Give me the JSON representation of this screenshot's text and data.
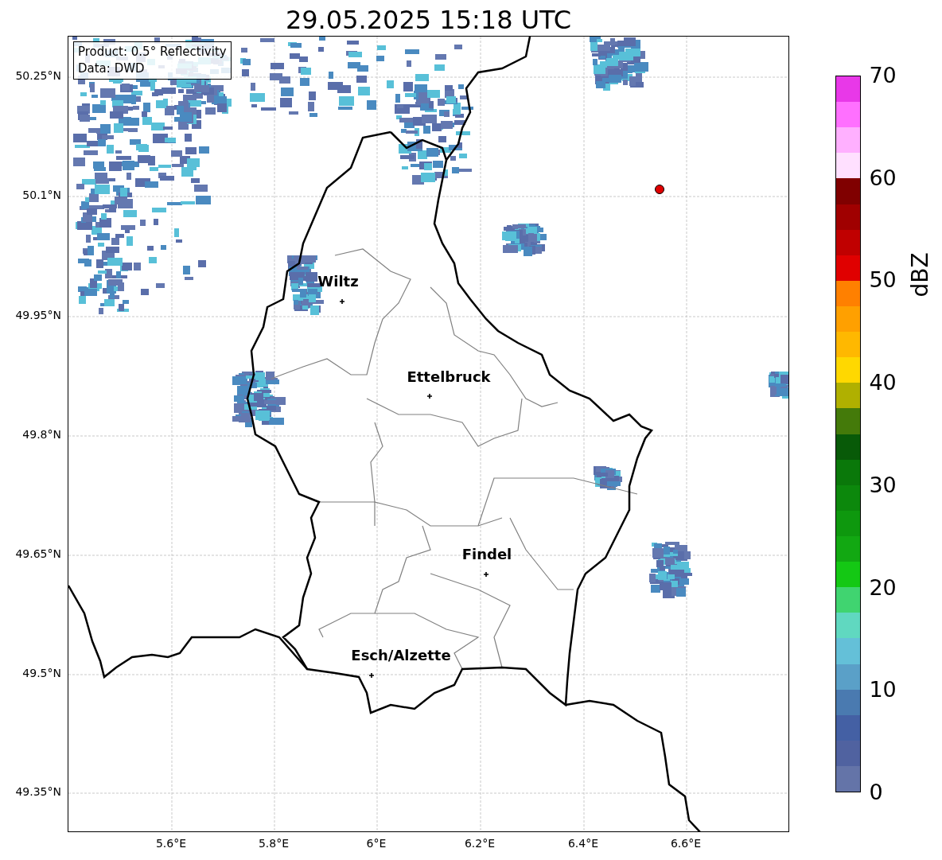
{
  "title": "29.05.2025 15:18 UTC",
  "info_box": {
    "lines": [
      "Product: 0.5° Reflectivity",
      "Data: DWD"
    ]
  },
  "map": {
    "xticks": [
      "5.6°E",
      "5.8°E",
      "6°E",
      "6.2°E",
      "6.4°E",
      "6.6°E"
    ],
    "yticks": [
      "50.25°N",
      "50.1°N",
      "49.95°N",
      "49.8°N",
      "49.65°N",
      "49.5°N",
      "49.35°N"
    ],
    "cities": [
      {
        "name": "Wiltz"
      },
      {
        "name": "Ettelbruck"
      },
      {
        "name": "Findel"
      },
      {
        "name": "Esch/Alzette"
      }
    ]
  },
  "colorbar": {
    "label": "dBZ",
    "ticks": [
      "70",
      "60",
      "50",
      "40",
      "30",
      "20",
      "10",
      "0"
    ],
    "segments": [
      {
        "color": "#e838e8"
      },
      {
        "color": "#ff70ff"
      },
      {
        "color": "#ffb0ff"
      },
      {
        "color": "#ffe0ff"
      },
      {
        "color": "#800000"
      },
      {
        "color": "#a00000"
      },
      {
        "color": "#c00000"
      },
      {
        "color": "#e00000"
      },
      {
        "color": "#ff8000"
      },
      {
        "color": "#ffa000"
      },
      {
        "color": "#ffb800"
      },
      {
        "color": "#ffd800"
      },
      {
        "color": "#b0b000"
      },
      {
        "color": "#447a0a"
      },
      {
        "color": "#085a08"
      },
      {
        "color": "#0a780a"
      },
      {
        "color": "#0c880c"
      },
      {
        "color": "#0e980e"
      },
      {
        "color": "#12a812"
      },
      {
        "color": "#14c814"
      },
      {
        "color": "#40d470"
      },
      {
        "color": "#60d8c0"
      },
      {
        "color": "#64c0d8"
      },
      {
        "color": "#5aa0c8"
      },
      {
        "color": "#4a7ab0"
      },
      {
        "color": "#4460a4"
      },
      {
        "color": "#5062a0"
      },
      {
        "color": "#6474a8"
      }
    ]
  }
}
